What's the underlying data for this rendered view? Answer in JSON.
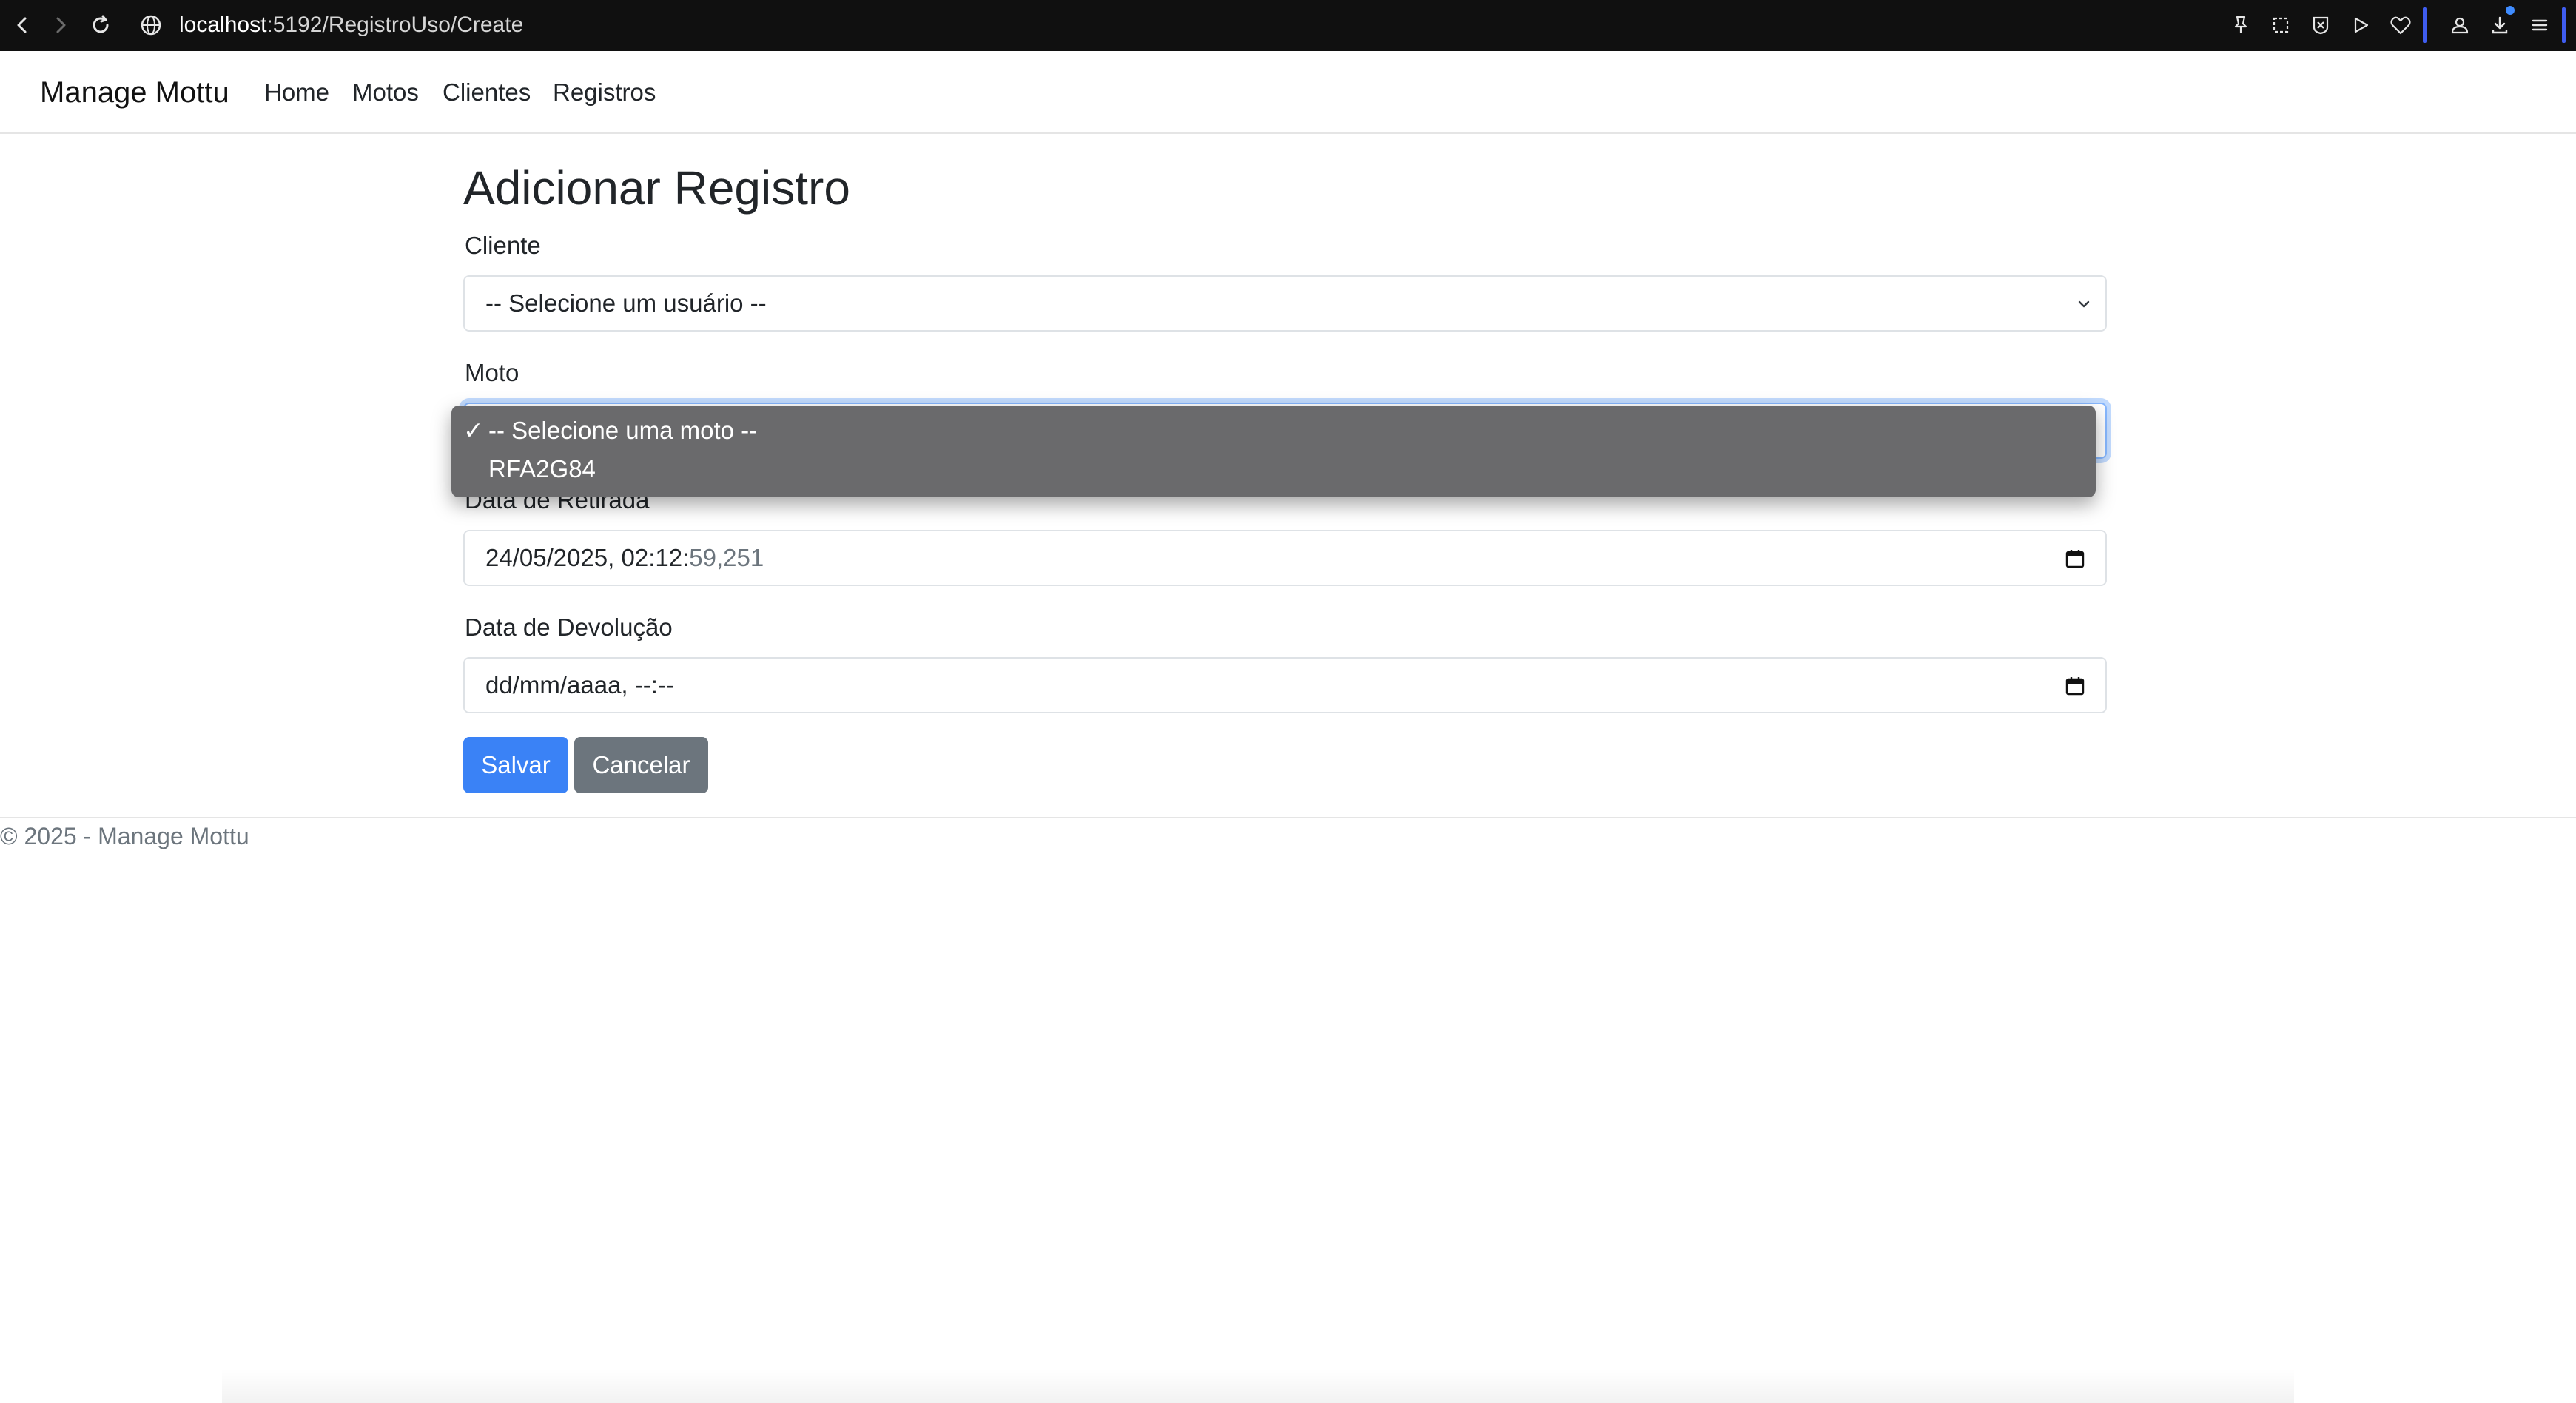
{
  "browser": {
    "url_host": "localhost",
    "url_path": ":5192/RegistroUso/Create"
  },
  "navbar": {
    "brand": "Manage Mottu",
    "links": [
      "Home",
      "Motos",
      "Clientes",
      "Registros"
    ]
  },
  "page": {
    "title": "Adicionar Registro"
  },
  "form": {
    "cliente": {
      "label": "Cliente",
      "selected": "-- Selecione um usuário --"
    },
    "moto": {
      "label": "Moto",
      "options": [
        "-- Selecione uma moto --",
        "RFA2G84"
      ],
      "selected_index": 0,
      "check": "✓"
    },
    "data_retirada": {
      "label": "Data de Retirada",
      "value_main": "24/05/2025, 02:12:",
      "value_seconds": "59,251"
    },
    "data_devolucao": {
      "label": "Data de Devolução",
      "placeholder": "dd/mm/aaaa, --:--"
    },
    "buttons": {
      "save": "Salvar",
      "cancel": "Cancelar"
    }
  },
  "footer": {
    "text": "© 2025 - Manage Mottu"
  },
  "colors": {
    "primary": "#3a82f6",
    "secondary": "#6c757d",
    "dropdown_bg": "#6a6a6c",
    "focus_border": "#86b7fe"
  }
}
